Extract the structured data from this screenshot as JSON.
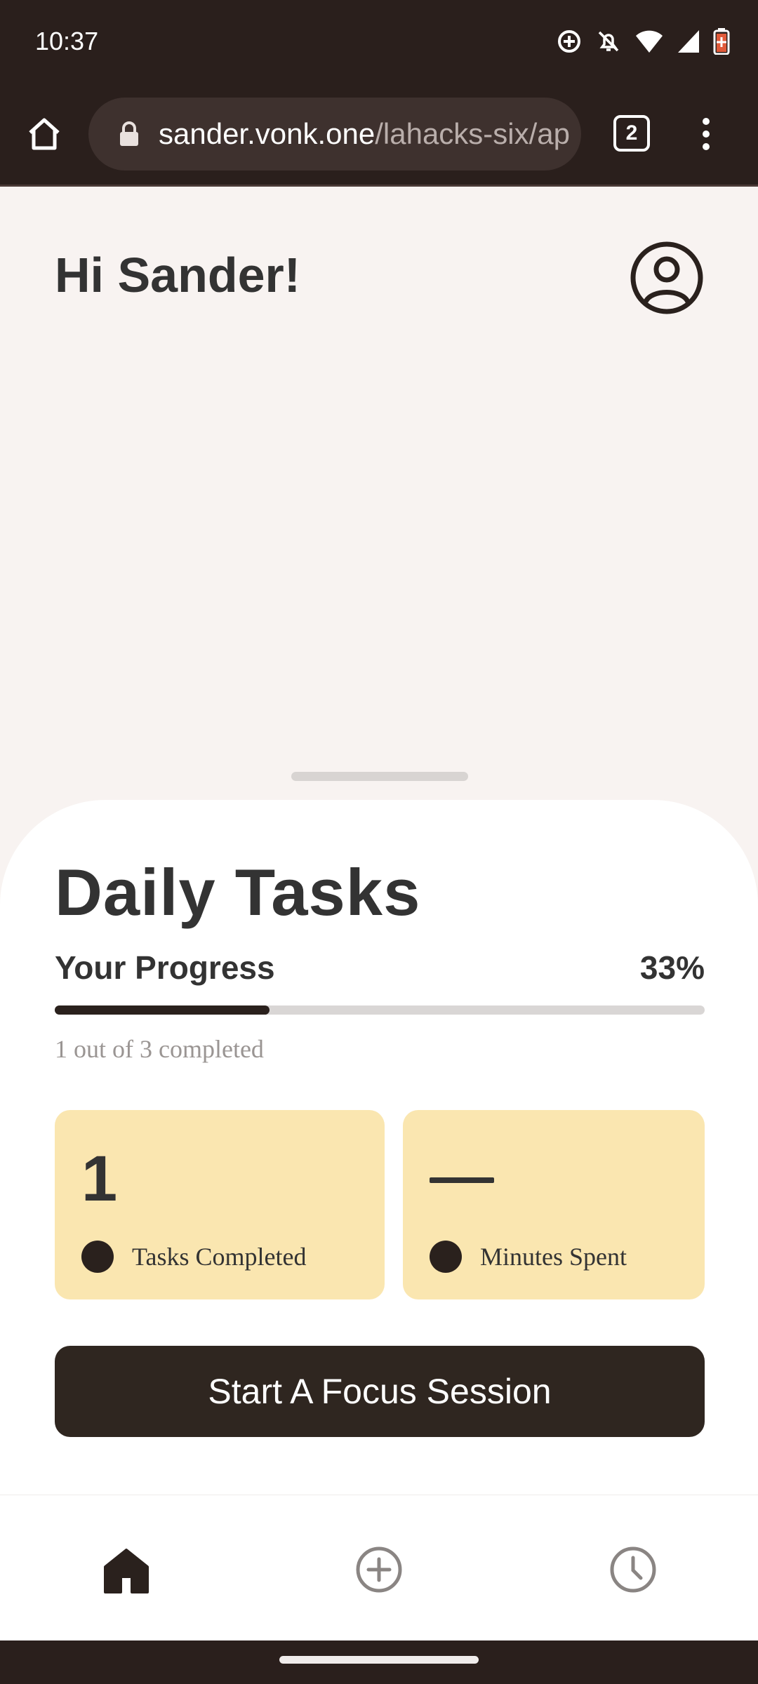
{
  "status_bar": {
    "time": "10:37",
    "icons": [
      "sync-icon",
      "bell-off-icon",
      "wifi-icon",
      "signal-icon",
      "battery-icon"
    ],
    "battery_color": "#e05a3a"
  },
  "browser": {
    "url_host": "sander.vonk.one",
    "url_path": "/lahacks-six/ap",
    "tab_count": "2"
  },
  "header": {
    "greeting": "Hi Sander!"
  },
  "daily_tasks": {
    "title": "Daily Tasks",
    "progress_label": "Your Progress",
    "progress_percent_text": "33%",
    "progress_value": 0.33,
    "progress_caption": "1 out of 3 completed"
  },
  "stats": {
    "tasks_completed_value": "1",
    "tasks_completed_label": "Tasks Completed",
    "minutes_spent_label": "Minutes Spent"
  },
  "actions": {
    "focus_button_label": "Start A Focus Session"
  },
  "nav": {
    "items": [
      "home-icon",
      "add-icon",
      "history-icon"
    ]
  },
  "colors": {
    "dark": "#2a1f1c",
    "card": "#fae6b0",
    "background": "#f8f3f1"
  }
}
